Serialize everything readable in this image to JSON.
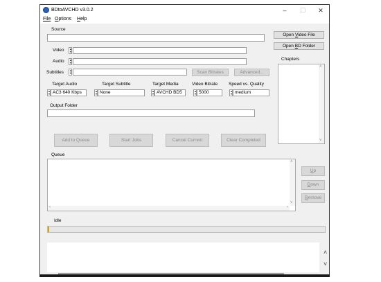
{
  "window": {
    "title": "BDtoAVCHD v3.0.2",
    "minimize": "–",
    "maximize": "☐",
    "close": "✕"
  },
  "menu": {
    "file": "File",
    "options": "Options",
    "help": "Help"
  },
  "source": {
    "label": "Source",
    "value": ""
  },
  "buttons": {
    "open_video_file": "Open Video File",
    "open_bd_folder": "Open BD Folder",
    "scan_bitrates": "Scan Bitrates",
    "advanced": "Advanced...",
    "add_to_queue": "Add to Queue",
    "start_jobs": "Start Jobs",
    "cancel_current": "Cancel Current",
    "clear_completed": "Clear Completed",
    "up": "Up",
    "down": "Down",
    "remove": "Remove"
  },
  "fields": {
    "video_label": "Video",
    "video_value": "",
    "audio_label": "Audio",
    "audio_value": "",
    "subtitles_label": "Subtitles",
    "subtitles_value": ""
  },
  "chapters": {
    "label": "Chapters"
  },
  "targets": {
    "audio_label": "Target Audio",
    "audio_value": "AC3 640 Kbps",
    "subtitle_label": "Target Subtitle",
    "subtitle_value": "None",
    "media_label": "Target Media",
    "media_value": "AVCHD BD5",
    "bitrate_label": "Video Bitrate",
    "bitrate_value": "5000",
    "speed_label": "Speed vs. Quality",
    "speed_value": "medium"
  },
  "output": {
    "label": "Output Folder",
    "value": ""
  },
  "queue": {
    "label": "Queue"
  },
  "status": {
    "text": "Idle",
    "progress": 0.0
  },
  "colors": {
    "progress_accent": "#d9a400",
    "window_bg": "#f0f0f0"
  }
}
